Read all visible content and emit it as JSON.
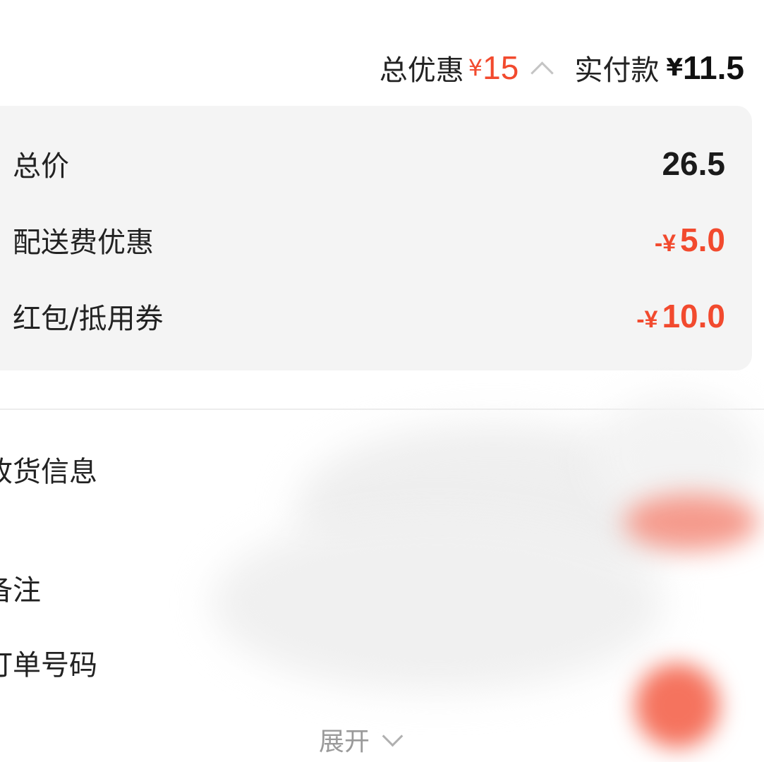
{
  "summary": {
    "total_discount_label": "总优惠",
    "currency_symbol": "¥",
    "total_discount_amount": "15",
    "toggle_icon": "chevron-up-icon",
    "amount_paid_label": "实付款",
    "amount_paid_value": "11.5"
  },
  "breakdown": {
    "rows": [
      {
        "label": "总价",
        "value": "26.5"
      },
      {
        "label": "配送费优惠",
        "prefix": "-¥",
        "value": "5.0"
      },
      {
        "label": "红包/抵用券",
        "prefix": "-¥",
        "value": "10.0"
      }
    ]
  },
  "info": {
    "rows": [
      {
        "label": "收货信息"
      },
      {
        "label": "备注"
      },
      {
        "label": "订单号码"
      }
    ]
  },
  "expand": {
    "label": "展开",
    "icon": "chevron-down-icon"
  },
  "colors": {
    "accent": "#f24a2e",
    "card_background": "#f4f4f4",
    "muted_text": "#9a9a9a"
  }
}
